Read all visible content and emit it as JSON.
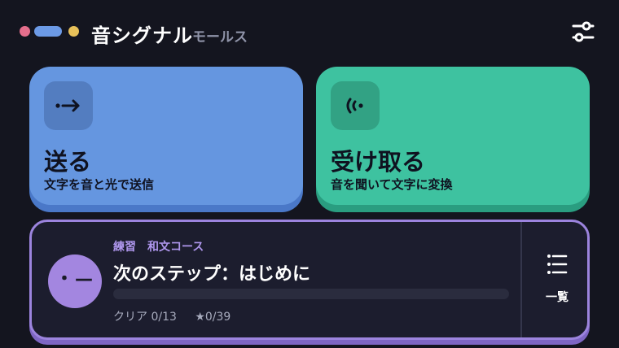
{
  "header": {
    "title": "音シグナル",
    "subtitle": "モールス",
    "settings_icon": "sliders-icon",
    "logo_colors": [
      "#e56e8c",
      "#6c9ae6",
      "#e8c15a"
    ]
  },
  "cards": {
    "send": {
      "title": "送る",
      "description": "文字を音と光で送信",
      "icon": "morse-send-icon",
      "color": "#6596e0"
    },
    "receive": {
      "title": "受け取る",
      "description": "音を聞いて文字に変換",
      "icon": "signal-receive-icon",
      "color": "#3ec2a0"
    }
  },
  "practice": {
    "tag": "練習　和文コース",
    "next_step": "次のステップ：はじめに",
    "avatar_text": "・—",
    "progress": 0,
    "clear_label": "クリア 0/13",
    "stars_label": "★0/39",
    "list_label": "一覧",
    "list_icon": "list-icon",
    "accent_color": "#9c84de"
  }
}
